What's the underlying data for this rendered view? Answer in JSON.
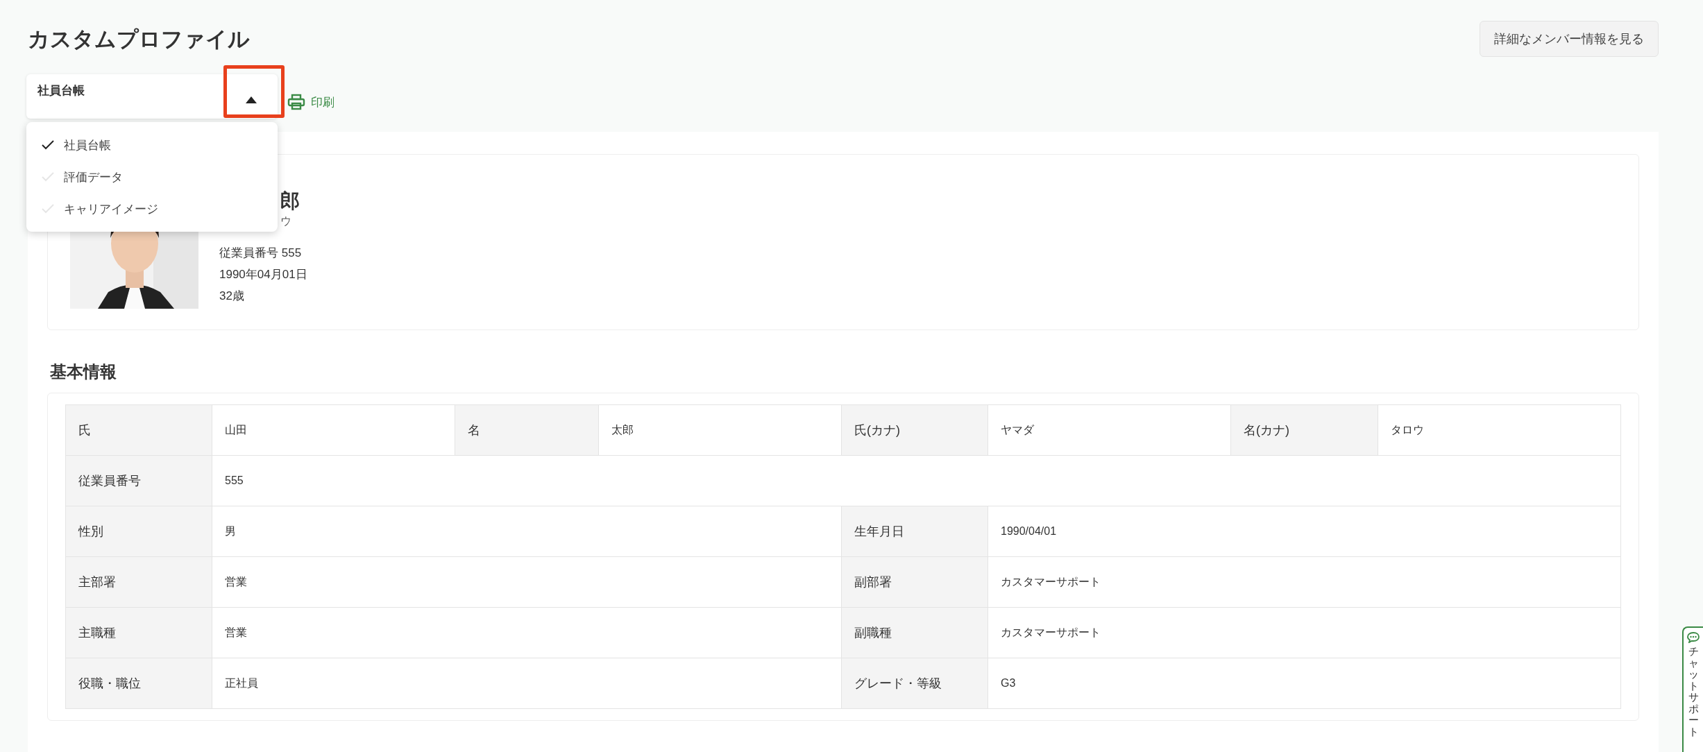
{
  "title": "カスタムプロファイル",
  "detail_button": "詳細なメンバー情報を見る",
  "profile_selector": {
    "value": "社員台帳",
    "expanded": true,
    "highlighted": true,
    "options": [
      {
        "label": "社員台帳",
        "selected": true
      },
      {
        "label": "評価データ",
        "selected": false
      },
      {
        "label": "キャリアイメージ",
        "selected": false
      }
    ]
  },
  "print_link": "印刷",
  "profile_card": {
    "name": "郎",
    "kana": "ウ",
    "photo": {
      "kind": "picture"
    },
    "lines": [
      "従業員番号 555",
      "1990年04月01日",
      "32歳"
    ]
  },
  "section_title": "基本情報",
  "table": {
    "rows": [
      {
        "cells": [
          {
            "label": "氏",
            "value": "山田"
          },
          {
            "label": "名",
            "value": "太郎"
          },
          {
            "label": "氏(カナ)",
            "value": "ヤマダ"
          },
          {
            "label": "名(カナ)",
            "value": "タロウ"
          }
        ]
      },
      {
        "cells": [
          {
            "label": "従業員番号",
            "value": "555"
          }
        ]
      },
      {
        "cells": [
          {
            "label": "性別",
            "value": "男"
          },
          {
            "label": "生年月日",
            "value": "1990/04/01"
          }
        ]
      },
      {
        "cells": [
          {
            "label": "主部署",
            "value": "営業"
          },
          {
            "label": "副部署",
            "value": "カスタマーサポート"
          }
        ]
      },
      {
        "cells": [
          {
            "label": "主職種",
            "value": "営業"
          },
          {
            "label": "副職種",
            "value": "カスタマーサポート"
          }
        ]
      },
      {
        "cells": [
          {
            "label": "役職・職位",
            "value": "正社員"
          },
          {
            "label": "グレード・等級",
            "value": "G3"
          }
        ]
      }
    ]
  },
  "chat_support": "チャットサポート"
}
